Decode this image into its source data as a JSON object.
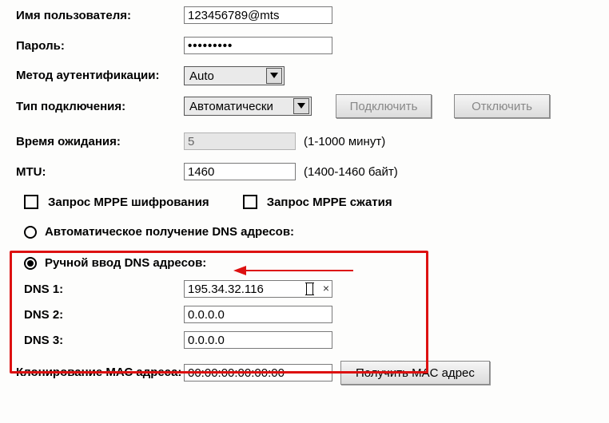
{
  "fields": {
    "username": {
      "label": "Имя пользователя:",
      "value": "123456789@mts"
    },
    "password": {
      "label": "Пароль:",
      "value": "•••••••••"
    },
    "auth": {
      "label": "Метод аутентификации:",
      "value": "Auto"
    },
    "conntype": {
      "label": "Тип подключения:",
      "value": "Автоматически"
    },
    "timeout": {
      "label": "Время ожидания:",
      "value": "5",
      "hint": "(1-1000 минут)"
    },
    "mtu": {
      "label": "MTU:",
      "value": "1460",
      "hint": "(1400-1460 байт)"
    }
  },
  "buttons": {
    "connect": "Подключить",
    "disconnect": "Отключить",
    "get_mac": "Получить MAC адрес"
  },
  "checks": {
    "mppe_enc": "Запрос MPPE шифрования",
    "mppe_comp": "Запрос MPPE сжатия"
  },
  "dns": {
    "auto": "Автоматическое получение DNS адресов:",
    "manual": "Ручной ввод DNS адресов:",
    "rows": [
      {
        "label": "DNS 1:",
        "value": "195.34.32.116"
      },
      {
        "label": "DNS 2:",
        "value": "0.0.0.0"
      },
      {
        "label": "DNS 3:",
        "value": "0.0.0.0"
      }
    ]
  },
  "mac": {
    "label": "Клонирование МАС адреса:",
    "value": "00:00:00:00:00:00"
  }
}
